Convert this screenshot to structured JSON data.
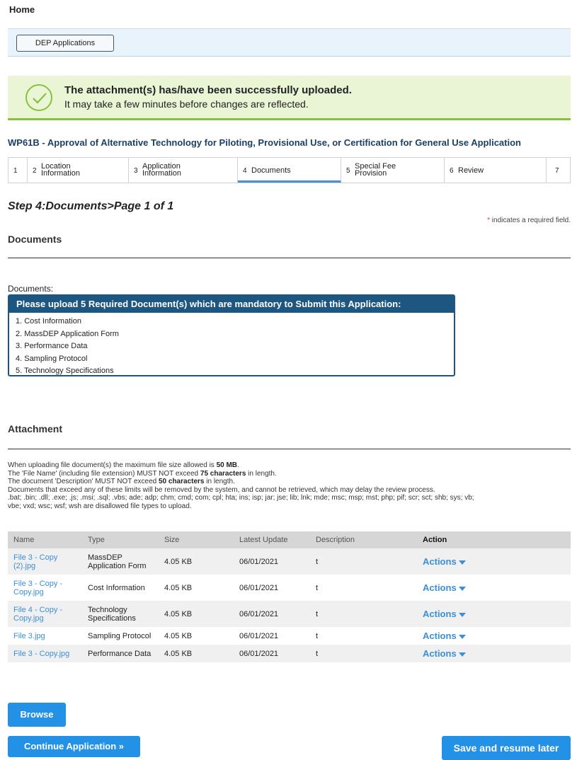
{
  "header": {
    "home": "Home"
  },
  "nav": {
    "dep_applications": "DEP Applications"
  },
  "success": {
    "title": "The attachment(s) has/have been successfully uploaded.",
    "subtitle": "It may take a few minutes before changes are reflected."
  },
  "page_heading": "WP61B - Approval of Alternative Technology for Piloting, Provisional Use, or Certification for General Use Application",
  "steps": [
    {
      "num": "1",
      "label": ""
    },
    {
      "num": "2",
      "label": "Location\nInformation"
    },
    {
      "num": "3",
      "label": "Application\nInformation"
    },
    {
      "num": "4",
      "label": "Documents"
    },
    {
      "num": "5",
      "label": "Special Fee\nProvision"
    },
    {
      "num": "6",
      "label": "Review"
    },
    {
      "num": "7",
      "label": ""
    }
  ],
  "step_title": "Step 4:Documents>Page 1 of 1",
  "required_note": {
    "star": "*",
    "text": " indicates a required field."
  },
  "documents_section": {
    "title": "Documents",
    "label": "Documents:",
    "required_header": "Please upload 5 Required Document(s) which are mandatory to Submit this Application:",
    "required_items": [
      "1. Cost Information",
      "2. MassDEP Application Form",
      "3. Performance Data",
      "4. Sampling Protocol",
      "5. Technology Specifications"
    ]
  },
  "attachment_section": {
    "title": "Attachment",
    "limits": {
      "line1_pre": "When uploading file document(s) the maximum file size allowed is ",
      "line1_bold": "50 MB",
      "line1_post": ".",
      "line2_pre": "The 'File Name' (including file extension) MUST NOT exceed ",
      "line2_bold": "75 characters",
      "line2_post": " in length.",
      "line3_pre": "The document 'Description' MUST NOT exceed ",
      "line3_bold": "50 characters",
      "line3_post": " in length.",
      "line4": "Documents that exceed any of these limits will be removed by the system, and cannot be retrieved, which may delay the review process.",
      "line5": ".bat; .bin; .dll; .exe; .js; .msi; .sql; .vbs; ade; adp; chm; cmd; com; cpl; hta; ins; isp; jar; jse; lib; lnk; mde; msc; msp; mst; php; pif; scr; sct; shb; sys; vb;",
      "line6": "vbe; vxd; wsc; wsf; wsh are disallowed file types to upload."
    },
    "columns": [
      "Name",
      "Type",
      "Size",
      "Latest Update",
      "Description",
      "Action"
    ],
    "rows": [
      {
        "name": "File 3 - Copy (2).jpg",
        "type": "MassDEP Application Form",
        "size": "4.05 KB",
        "updated": "06/01/2021",
        "description": "t",
        "action": "Actions"
      },
      {
        "name": "File 3 - Copy - Copy.jpg",
        "type": "Cost Information",
        "size": "4.05 KB",
        "updated": "06/01/2021",
        "description": "t",
        "action": "Actions"
      },
      {
        "name": "File 4 - Copy - Copy.jpg",
        "type": "Technology Specifications",
        "size": "4.05 KB",
        "updated": "06/01/2021",
        "description": "t",
        "action": "Actions"
      },
      {
        "name": "File 3.jpg",
        "type": "Sampling Protocol",
        "size": "4.05 KB",
        "updated": "06/01/2021",
        "description": "t",
        "action": "Actions"
      },
      {
        "name": "File 3 - Copy.jpg",
        "type": "Performance Data",
        "size": "4.05 KB",
        "updated": "06/01/2021",
        "description": "t",
        "action": "Actions"
      }
    ]
  },
  "buttons": {
    "browse": "Browse",
    "continue": "Continue Application »",
    "save_resume": "Save and resume later"
  },
  "colors": {
    "accent_blue": "#2391e6",
    "link_blue": "#3a8fd9",
    "success_green": "#86c23d",
    "header_navy": "#1d5781"
  },
  "icons": {
    "success": "check-circle-icon",
    "dropdown": "caret-down-icon"
  }
}
